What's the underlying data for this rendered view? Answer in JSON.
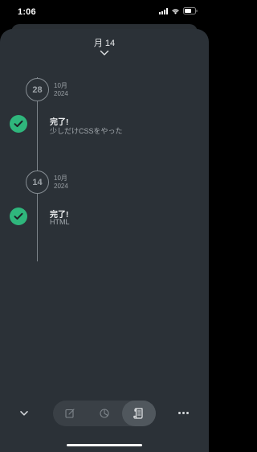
{
  "status_bar": {
    "time": "1:06",
    "icons": [
      "signal-icon",
      "wifi-icon",
      "battery-icon"
    ]
  },
  "header": {
    "title": "月 14",
    "icon": "chevron-down-icon"
  },
  "timeline": {
    "line_color": "#7c8389",
    "entries": [
      {
        "day": "28",
        "month": "10月",
        "year": "2024",
        "status_icon": "check-icon",
        "title": "完了!",
        "subtitle": "少しだけCSSをやった"
      },
      {
        "day": "14",
        "month": "10月",
        "year": "2024",
        "status_icon": "check-icon",
        "title": "完了!",
        "subtitle": "HTML"
      }
    ]
  },
  "toolbar": {
    "collapse_icon": "chevron-down-icon",
    "tabs": [
      {
        "icon": "edit-icon",
        "active": false
      },
      {
        "icon": "pie-chart-icon",
        "active": false
      },
      {
        "icon": "scroll-icon",
        "active": true
      }
    ],
    "more_icon": "more-icon"
  },
  "colors": {
    "background": "#2b3137",
    "accent_check": "#2fb67c",
    "text_primary": "#f1f3f4",
    "text_secondary": "#a4aaaf"
  }
}
